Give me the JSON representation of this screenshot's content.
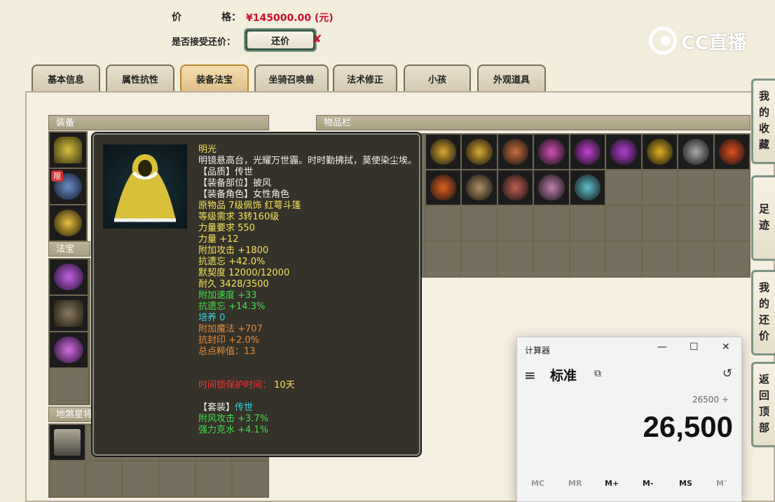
{
  "header": {
    "price_label": "价",
    "price_label2": "格：",
    "price_value": "¥145000.00 (元)",
    "accept_label": "是否接受还价：",
    "counter_button": "还价",
    "counter_mark": "✘"
  },
  "logo": {
    "text": "CC直播"
  },
  "tabs": [
    "基本信息",
    "属性抗性",
    "装备法宝",
    "坐骑召唤兽",
    "法术修正",
    "小孩",
    "外观道具"
  ],
  "active_tab": "装备法宝",
  "panels": {
    "equipment": "装备",
    "treasure": "法宝",
    "inventory": "物品栏",
    "star": "地煞星将"
  },
  "equip_badge": "限",
  "tooltip": {
    "name": "明光",
    "desc": "明镜悬高台，光耀万世霾。时时勤拂拭，莫使染尘埃。",
    "lines": [
      {
        "text": "【品质】传世",
        "color": "white"
      },
      {
        "text": "【装备部位】披风",
        "color": "white"
      },
      {
        "text": "【装备角色】女性角色",
        "color": "white"
      },
      {
        "text": "原物品 7级佩饰 红萼斗篷",
        "color": "yellow"
      },
      {
        "text": "等级需求 3转160级",
        "color": "yellow"
      },
      {
        "text": "力量要求 550",
        "color": "yellow"
      },
      {
        "text": "力量 +12",
        "color": "yellow"
      },
      {
        "text": "附加攻击 +1800",
        "color": "yellow"
      },
      {
        "text": "抗遗忘 +42.0%",
        "color": "yellow"
      },
      {
        "text": "默契度 12000/12000",
        "color": "yellow"
      },
      {
        "text": "耐久 3428/3500",
        "color": "yellow"
      },
      {
        "text": "附加速度 +33",
        "color": "green"
      },
      {
        "text": "抗遗忘 +14.3%",
        "color": "green"
      },
      {
        "text": "培养 0",
        "color": "cyan"
      },
      {
        "text": "附加魔法 +707",
        "color": "orange"
      },
      {
        "text": "抗封印 +2.0%",
        "color": "orange"
      },
      {
        "text": "总点粹值：13",
        "color": "orange"
      }
    ],
    "protect_label": "时间锁保护时间：",
    "protect_value": "10天",
    "set_label": "【套装】",
    "set_value": "传世",
    "set_lines": [
      "附风攻击 +3.7%",
      "强力克水 +4.1%"
    ]
  },
  "sidebar": [
    "我的收藏",
    "足迹",
    "我的还价",
    "返回顶部"
  ],
  "calculator": {
    "title": "计算器",
    "minimize": "—",
    "maximize": "☐",
    "close": "✕",
    "menu_icon": "≡",
    "mode": "标准",
    "keep_on_top_icon": "⧉",
    "history_icon": "↺",
    "expression": "26500 +",
    "display": "26,500",
    "memory": [
      "MC",
      "MR",
      "M+",
      "M-",
      "MS",
      "M˅"
    ]
  }
}
